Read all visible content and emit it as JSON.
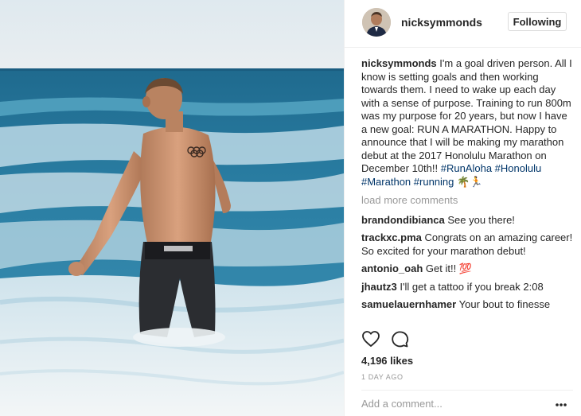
{
  "post": {
    "author": "nicksymmonds",
    "follow_label": "Following",
    "caption": {
      "text": "I'm a goal driven person. All I know is setting goals and then working towards them. I need to wake up each day with a sense of purpose. Training to run 800m was my purpose for 20 years, but now I have a new goal: RUN A MARATHON. Happy to announce that I will be making my marathon debut at the 2017 Honolulu Marathon on December 10th!! ",
      "tags": [
        "#RunAloha",
        "#Honolulu",
        "#Marathon",
        "#running"
      ],
      "emoji": "🌴🏃"
    },
    "load_more": "load more comments",
    "comments": [
      {
        "user": "brandondibianca",
        "text": "See you there!"
      },
      {
        "user": "trackxc.pma",
        "text": "Congrats on an amazing career! So excited for your marathon debut!"
      },
      {
        "user": "antonio_oah",
        "text": "Get it!! 💯"
      },
      {
        "user": "jhautz3",
        "text": "I'll get a tattoo if you break 2:08"
      },
      {
        "user": "samuelauernhamer",
        "text": "Your bout to finesse"
      }
    ],
    "likes": "4,196 likes",
    "time_ago": "1 DAY AGO",
    "add_comment_placeholder": "Add a comment..."
  },
  "icons": {
    "like": "heart-icon",
    "comment": "comment-icon",
    "more": "more-options-icon"
  }
}
